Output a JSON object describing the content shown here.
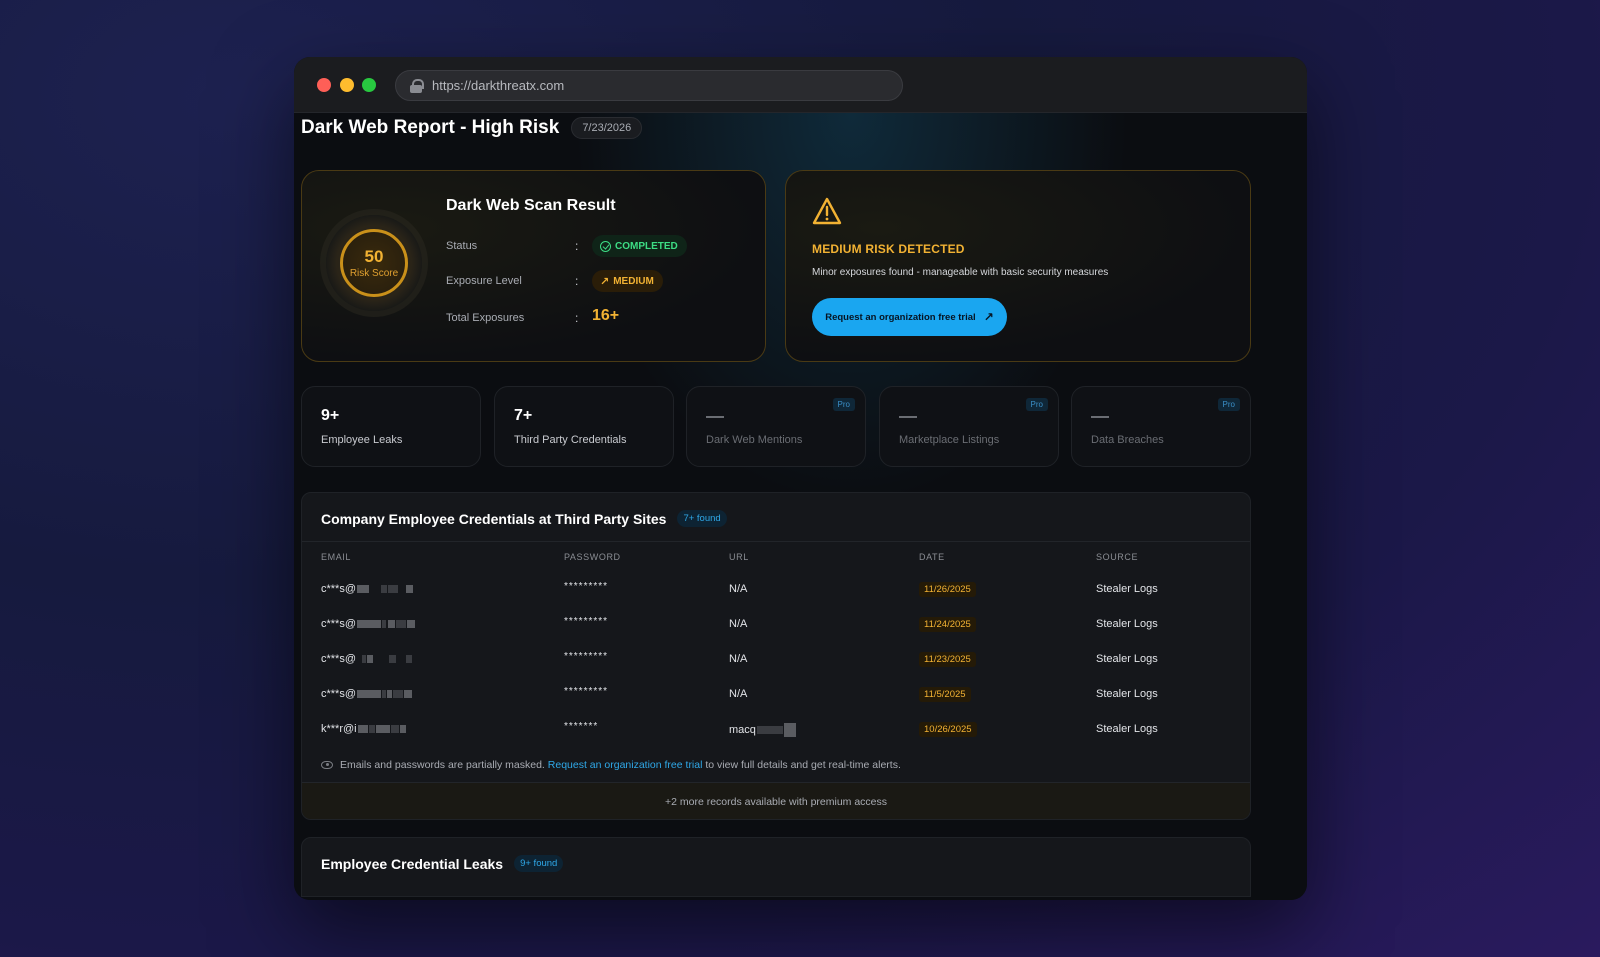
{
  "browser": {
    "url": "https://darkthreatx.com"
  },
  "header": {
    "title": "Dark Web Report - High Risk",
    "date": "7/23/2026"
  },
  "scan": {
    "title": "Dark Web Scan Result",
    "risk_score": "50",
    "risk_score_label": "Risk Score",
    "status_label": "Status",
    "status_value": "COMPLETED",
    "exposure_label": "Exposure Level",
    "exposure_value": "MEDIUM",
    "total_label": "Total Exposures",
    "total_value": "16+",
    "colon": ":"
  },
  "risk": {
    "title": "MEDIUM RISK DETECTED",
    "description": "Minor exposures found - manageable with basic security measures",
    "button_label": "Request an organization free trial",
    "icon": "warning-triangle-icon"
  },
  "stats": [
    {
      "value": "9+",
      "label": "Employee Leaks",
      "pro": ""
    },
    {
      "value": "7+",
      "label": "Third Party Credentials",
      "pro": ""
    },
    {
      "value": "",
      "label": "Dark Web Mentions",
      "pro": "Pro"
    },
    {
      "value": "",
      "label": "Marketplace Listings",
      "pro": "Pro"
    },
    {
      "value": "",
      "label": "Data Breaches",
      "pro": "Pro"
    }
  ],
  "credentials_panel": {
    "title": "Company Employee Credentials at Third Party Sites",
    "badge": "7+ found",
    "columns": [
      "EMAIL",
      "PASSWORD",
      "URL",
      "DATE",
      "SOURCE"
    ],
    "rows": [
      {
        "email": "c***s@",
        "password": "*********",
        "url": "N/A",
        "date": "11/26/2025",
        "source": "Stealer Logs"
      },
      {
        "email": "c***s@",
        "password": "*********",
        "url": "N/A",
        "date": "11/24/2025",
        "source": "Stealer Logs"
      },
      {
        "email": "c***s@",
        "password": "*********",
        "url": "N/A",
        "date": "11/23/2025",
        "source": "Stealer Logs"
      },
      {
        "email": "c***s@",
        "password": "*********",
        "url": "N/A",
        "date": "11/5/2025",
        "source": "Stealer Logs"
      },
      {
        "email": "k***r@i",
        "password": "*******",
        "url": "macq",
        "date": "10/26/2025",
        "source": "Stealer Logs"
      }
    ],
    "note_prefix": "Emails and passwords are partially masked.",
    "note_link": "Request an organization free trial",
    "note_suffix": "to view full details and get real-time alerts.",
    "more_records": "+2 more records available with premium access"
  },
  "leaks_panel": {
    "title": "Employee Credential Leaks",
    "badge": "9+ found"
  }
}
